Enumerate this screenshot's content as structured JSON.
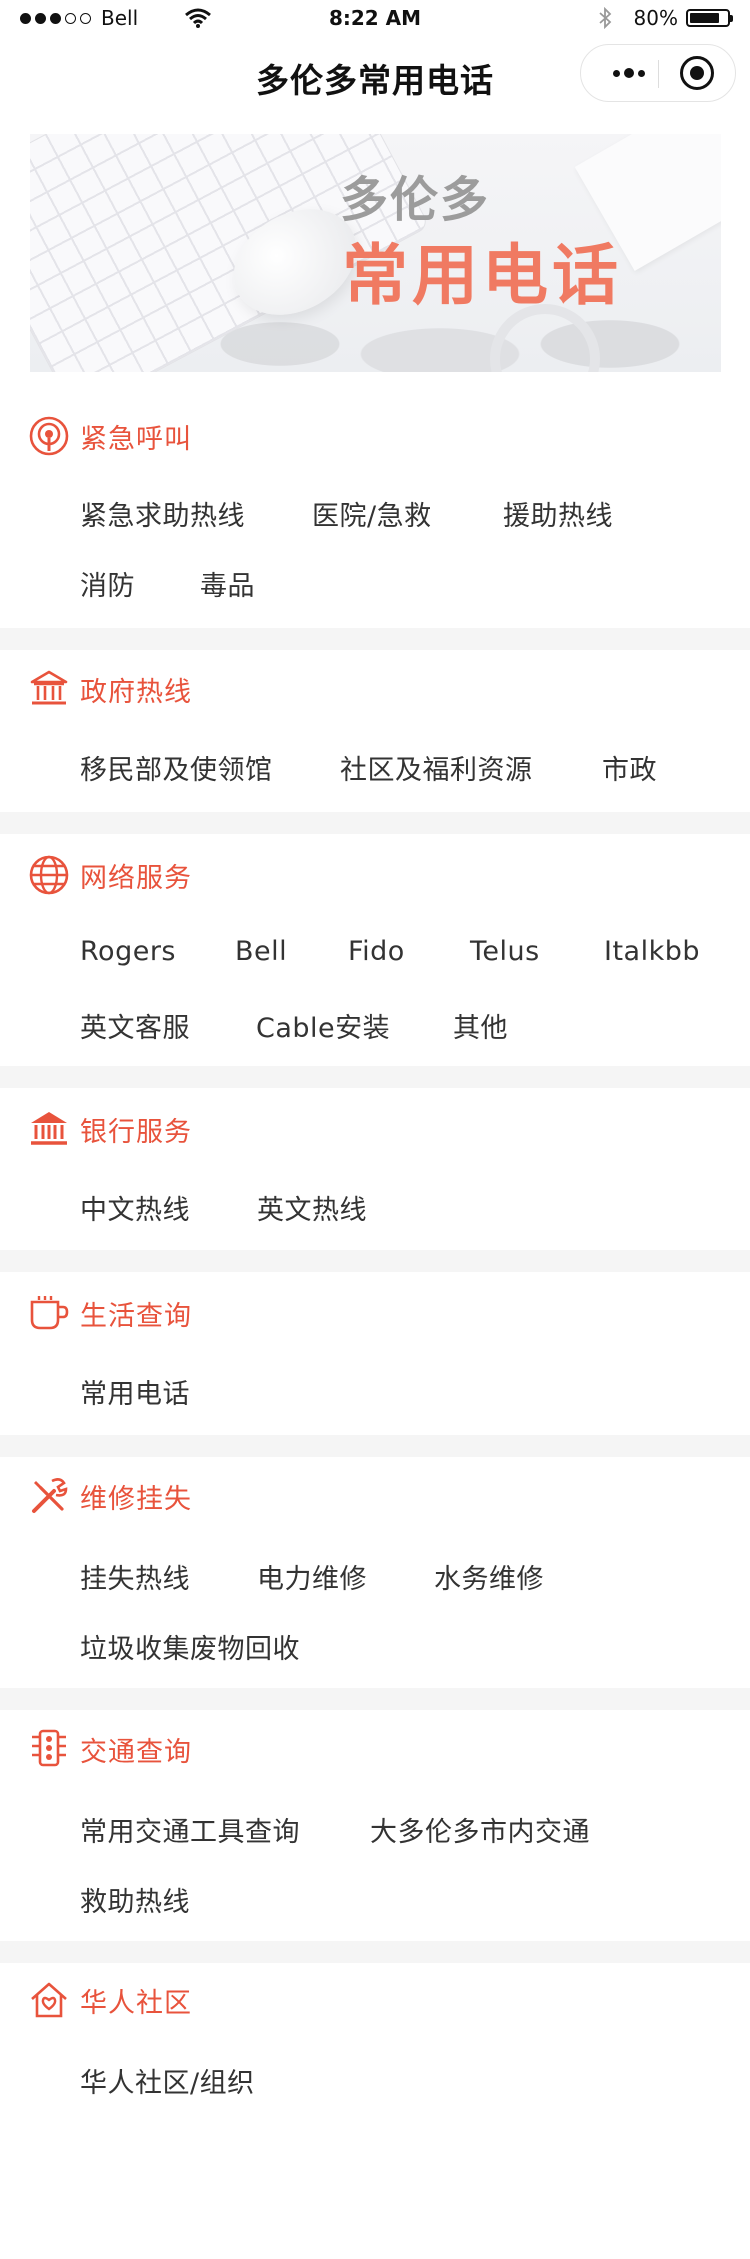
{
  "status_bar": {
    "carrier": "Bell",
    "time": "8:22 AM",
    "battery": "80%",
    "battery_level": 0.8
  },
  "nav": {
    "title": "多伦多常用电话"
  },
  "banner": {
    "line1": "多伦多",
    "line2": "常用电话"
  },
  "sections": [
    {
      "title": "紧急呼叫",
      "icon": "emergency-icon",
      "items": [
        "紧急求助热线",
        "医院/急救",
        "援助热线",
        "消防",
        "毒品"
      ]
    },
    {
      "title": "政府热线",
      "icon": "government-icon",
      "items": [
        "移民部及使领馆",
        "社区及福利资源",
        "市政"
      ]
    },
    {
      "title": "网络服务",
      "icon": "globe-icon",
      "items": [
        "Rogers",
        "Bell",
        "Fido",
        "Telus",
        "Italkbb",
        "英文客服",
        "Cable安装",
        "其他"
      ]
    },
    {
      "title": "银行服务",
      "icon": "bank-icon",
      "items": [
        "中文热线",
        "英文热线"
      ]
    },
    {
      "title": "生活查询",
      "icon": "coffee-cup-icon",
      "items": [
        "常用电话"
      ]
    },
    {
      "title": "维修挂失",
      "icon": "tools-icon",
      "items": [
        "挂失热线",
        "电力维修",
        "水务维修",
        "垃圾收集废物回收"
      ]
    },
    {
      "title": "交通查询",
      "icon": "traffic-light-icon",
      "items": [
        "常用交通工具查询",
        "大多伦多市内交通",
        "救助热线"
      ]
    },
    {
      "title": "华人社区",
      "icon": "community-icon",
      "items": [
        "华人社区/组织"
      ]
    }
  ],
  "colors": {
    "accent": "#e8533c",
    "text": "#333333",
    "divider": "#f5f5f5"
  }
}
